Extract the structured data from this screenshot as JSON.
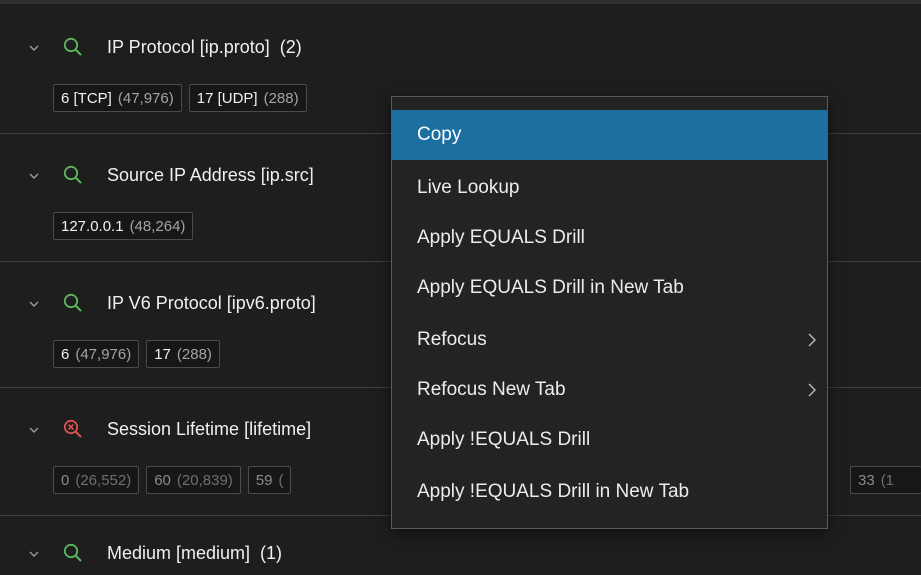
{
  "sections": [
    {
      "title": "IP Protocol [ip.proto]",
      "count": "(2)",
      "icon": "search-icon",
      "values": [
        {
          "value": "6 [TCP]",
          "count": "(47,976)"
        },
        {
          "value": "17 [UDP]",
          "count": "(288)"
        }
      ]
    },
    {
      "title": "Source IP Address [ip.src]",
      "count": "",
      "icon": "search-icon",
      "values": [
        {
          "value": "127.0.0.1",
          "count": "(48,264)"
        }
      ]
    },
    {
      "title": "IP V6 Protocol [ipv6.proto]",
      "count": "",
      "icon": "search-icon",
      "values": [
        {
          "value": "6",
          "count": "(47,976)"
        },
        {
          "value": "17",
          "count": "(288)"
        }
      ]
    },
    {
      "title": "Session Lifetime [lifetime]",
      "count": "",
      "icon": "search-error-icon",
      "values": [
        {
          "value": "0",
          "count": "(26,552)"
        },
        {
          "value": "60",
          "count": "(20,839)"
        },
        {
          "value": "59",
          "count": "("
        },
        {
          "value": "33",
          "count": "(1"
        }
      ]
    },
    {
      "title": "Medium [medium]",
      "count": "(1)",
      "icon": "search-icon",
      "values": []
    }
  ],
  "context_menu": {
    "items": [
      {
        "label": "Copy",
        "active": true,
        "submenu": false
      },
      {
        "label": "Live Lookup",
        "active": false,
        "submenu": false
      },
      {
        "label": "Apply EQUALS Drill",
        "active": false,
        "submenu": false
      },
      {
        "label": "Apply EQUALS Drill in New Tab",
        "active": false,
        "submenu": false
      },
      {
        "label": "Refocus",
        "active": false,
        "submenu": true
      },
      {
        "label": "Refocus New Tab",
        "active": false,
        "submenu": true
      },
      {
        "label": "Apply !EQUALS Drill",
        "active": false,
        "submenu": false
      },
      {
        "label": "Apply !EQUALS Drill in New Tab",
        "active": false,
        "submenu": false
      }
    ]
  },
  "colors": {
    "background": "#1e1e1e",
    "search_icon": "#5cb85c",
    "error_icon": "#d9534f",
    "menu_highlight": "#1d6fa1"
  }
}
